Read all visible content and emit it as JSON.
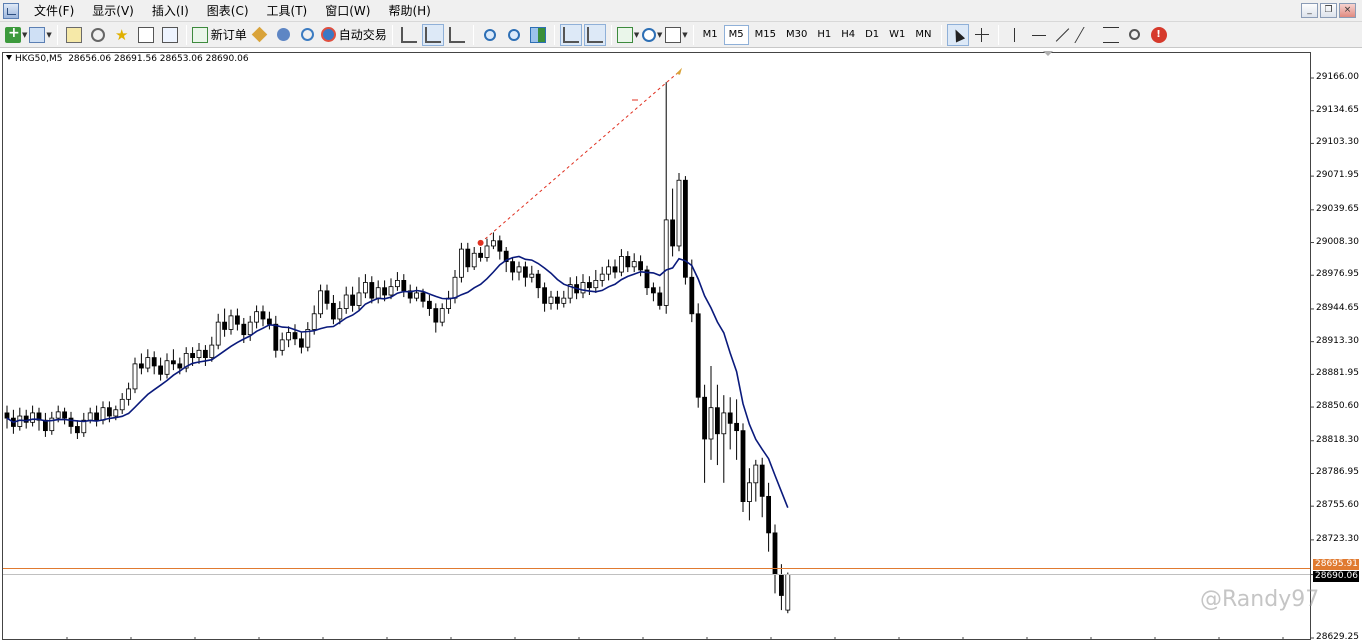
{
  "menu": {
    "items": [
      {
        "id": "file",
        "label": "文件(F)"
      },
      {
        "id": "view",
        "label": "显示(V)"
      },
      {
        "id": "insert",
        "label": "插入(I)"
      },
      {
        "id": "charts",
        "label": "图表(C)"
      },
      {
        "id": "tools",
        "label": "工具(T)"
      },
      {
        "id": "window",
        "label": "窗口(W)"
      },
      {
        "id": "help",
        "label": "帮助(H)"
      }
    ]
  },
  "window_controls": {
    "minimize": "_",
    "restore": "❐",
    "close": "×"
  },
  "toolbar": {
    "new_order_label": "新订单",
    "auto_trading_label": "自动交易",
    "alert_glyph": "!",
    "timeframes": [
      {
        "label": "M1",
        "active": false
      },
      {
        "label": "M5",
        "active": true
      },
      {
        "label": "M15",
        "active": false
      },
      {
        "label": "M30",
        "active": false
      },
      {
        "label": "H1",
        "active": false
      },
      {
        "label": "H4",
        "active": false
      },
      {
        "label": "D1",
        "active": false
      },
      {
        "label": "W1",
        "active": false
      },
      {
        "label": "MN",
        "active": false
      }
    ]
  },
  "chart_header": {
    "symbol": "HKG50,M5",
    "ohlc": "28656.06 28691.56 28653.06 28690.06"
  },
  "price_axis": {
    "labels": [
      "29166.00",
      "29134.65",
      "29103.30",
      "29071.95",
      "29039.65",
      "29008.30",
      "28976.95",
      "28944.65",
      "28913.30",
      "28881.95",
      "28850.60",
      "28818.30",
      "28786.95",
      "28755.60",
      "28723.30",
      "28690.06",
      "28629.25"
    ],
    "bid_price_tag": "28690.06",
    "ask_price_tag": "28695.91"
  },
  "watermark": "@Randy97",
  "colors": {
    "ma_line": "#0a1a7c",
    "trade_line": "#e03020",
    "bid_line": "#c0c0c0",
    "ask_line": "#e07a30",
    "candle_bear": "#000000",
    "candle_bull": "#ffffff",
    "tick_label_bg": "#000000",
    "ask_tag_bg": "#e07a30"
  },
  "chart_data": {
    "type": "candlestick",
    "symbol": "HKG50",
    "timeframe": "M5",
    "ylim": [
      28629.25,
      29180.0
    ],
    "grid": false,
    "indicators": [
      "moving average"
    ],
    "candles": [
      [
        28845,
        28840,
        28852,
        28830
      ],
      [
        28840,
        28832,
        28848,
        28825
      ],
      [
        28832,
        28842,
        28850,
        28828
      ],
      [
        28842,
        28836,
        28848,
        28830
      ],
      [
        28836,
        28845,
        28852,
        28832
      ],
      [
        28845,
        28838,
        28850,
        28828
      ],
      [
        28838,
        28828,
        28845,
        28822
      ],
      [
        28828,
        28840,
        28846,
        28824
      ],
      [
        28840,
        28846,
        28852,
        28836
      ],
      [
        28846,
        28840,
        28850,
        28834
      ],
      [
        28840,
        28832,
        28846,
        28825
      ],
      [
        28832,
        28826,
        28838,
        28820
      ],
      [
        28826,
        28838,
        28845,
        28822
      ],
      [
        28838,
        28845,
        28850,
        28835
      ],
      [
        28845,
        28838,
        28852,
        28832
      ],
      [
        28838,
        28850,
        28856,
        28834
      ],
      [
        28850,
        28842,
        28856,
        28836
      ],
      [
        28842,
        28848,
        28852,
        28838
      ],
      [
        28848,
        28858,
        28864,
        28844
      ],
      [
        28858,
        28868,
        28874,
        28852
      ],
      [
        28868,
        28892,
        28898,
        28864
      ],
      [
        28892,
        28888,
        28902,
        28882
      ],
      [
        28888,
        28898,
        28906,
        28884
      ],
      [
        28898,
        28890,
        28904,
        28882
      ],
      [
        28890,
        28882,
        28898,
        28876
      ],
      [
        28882,
        28895,
        28902,
        28878
      ],
      [
        28895,
        28892,
        28906,
        28886
      ],
      [
        28892,
        28888,
        28898,
        28882
      ],
      [
        28888,
        28902,
        28908,
        28884
      ],
      [
        28902,
        28898,
        28908,
        28890
      ],
      [
        28898,
        28905,
        28912,
        28892
      ],
      [
        28905,
        28898,
        28910,
        28890
      ],
      [
        28898,
        28910,
        28918,
        28894
      ],
      [
        28910,
        28932,
        28940,
        28906
      ],
      [
        28932,
        28925,
        28945,
        28918
      ],
      [
        28925,
        28938,
        28944,
        28920
      ],
      [
        28938,
        28930,
        28945,
        28924
      ],
      [
        28930,
        28920,
        28936,
        28912
      ],
      [
        28920,
        28932,
        28938,
        28914
      ],
      [
        28932,
        28942,
        28948,
        28926
      ],
      [
        28942,
        28935,
        28948,
        28928
      ],
      [
        28935,
        28930,
        28942,
        28925
      ],
      [
        28930,
        28905,
        28938,
        28898
      ],
      [
        28905,
        28915,
        28922,
        28900
      ],
      [
        28915,
        28922,
        28928,
        28908
      ],
      [
        28922,
        28916,
        28930,
        28910
      ],
      [
        28916,
        28908,
        28922,
        28902
      ],
      [
        28908,
        28925,
        28932,
        28904
      ],
      [
        28925,
        28940,
        28948,
        28920
      ],
      [
        28940,
        28962,
        28968,
        28936
      ],
      [
        28962,
        28950,
        28968,
        28944
      ],
      [
        28950,
        28935,
        28958,
        28930
      ],
      [
        28935,
        28945,
        28952,
        28930
      ],
      [
        28945,
        28958,
        28966,
        28940
      ],
      [
        28958,
        28948,
        28966,
        28942
      ],
      [
        28948,
        28960,
        28975,
        28944
      ],
      [
        28960,
        28970,
        28978,
        28955
      ],
      [
        28970,
        28955,
        28976,
        28950
      ],
      [
        28955,
        28965,
        28972,
        28950
      ],
      [
        28965,
        28958,
        28972,
        28952
      ],
      [
        28958,
        28966,
        28974,
        28954
      ],
      [
        28966,
        28972,
        28980,
        28962
      ],
      [
        28972,
        28962,
        28978,
        28956
      ],
      [
        28962,
        28955,
        28968,
        28950
      ],
      [
        28955,
        28960,
        28966,
        28952
      ],
      [
        28960,
        28952,
        28964,
        28946
      ],
      [
        28952,
        28945,
        28958,
        28938
      ],
      [
        28945,
        28932,
        28950,
        28922
      ],
      [
        28932,
        28945,
        28950,
        28928
      ],
      [
        28945,
        28955,
        28962,
        28940
      ],
      [
        28955,
        28975,
        28982,
        28950
      ],
      [
        28975,
        29002,
        29008,
        28970
      ],
      [
        29002,
        28985,
        29008,
        28980
      ],
      [
        28985,
        28998,
        29004,
        28982
      ],
      [
        28998,
        28994,
        29004,
        28990
      ],
      [
        28994,
        29005,
        29012,
        28990
      ],
      [
        29005,
        29010,
        29018,
        29002
      ],
      [
        29010,
        29000,
        29015,
        28992
      ],
      [
        29000,
        28990,
        29004,
        28980
      ],
      [
        28990,
        28980,
        28994,
        28972
      ],
      [
        28980,
        28985,
        28990,
        28972
      ],
      [
        28985,
        28975,
        28990,
        28966
      ],
      [
        28975,
        28978,
        28986,
        28970
      ],
      [
        28978,
        28965,
        28982,
        28955
      ],
      [
        28965,
        28950,
        28970,
        28942
      ],
      [
        28950,
        28956,
        28962,
        28944
      ],
      [
        28956,
        28950,
        28962,
        28944
      ],
      [
        28950,
        28955,
        28962,
        28946
      ],
      [
        28955,
        28968,
        28975,
        28950
      ],
      [
        28968,
        28960,
        28976,
        28954
      ],
      [
        28960,
        28970,
        28978,
        28955
      ],
      [
        28970,
        28965,
        28976,
        28958
      ],
      [
        28965,
        28972,
        28982,
        28960
      ],
      [
        28972,
        28978,
        28985,
        28966
      ],
      [
        28978,
        28985,
        28992,
        28972
      ],
      [
        28985,
        28980,
        28992,
        28974
      ],
      [
        28980,
        28995,
        29002,
        28976
      ],
      [
        28995,
        28985,
        29000,
        28980
      ],
      [
        28985,
        28990,
        28998,
        28980
      ],
      [
        28990,
        28982,
        28996,
        28976
      ],
      [
        28982,
        28965,
        28986,
        28958
      ],
      [
        28965,
        28960,
        28970,
        28952
      ],
      [
        28960,
        28948,
        28966,
        28944
      ],
      [
        28948,
        29030,
        29162,
        28940
      ],
      [
        29030,
        29005,
        29060,
        28995
      ],
      [
        29005,
        29068,
        29075,
        29000
      ],
      [
        29068,
        28975,
        29072,
        28968
      ],
      [
        28975,
        28940,
        28992,
        28932
      ],
      [
        28940,
        28860,
        28950,
        28850
      ],
      [
        28860,
        28820,
        28872,
        28778
      ],
      [
        28820,
        28850,
        28890,
        28800
      ],
      [
        28850,
        28825,
        28872,
        28795
      ],
      [
        28825,
        28845,
        28862,
        28778
      ],
      [
        28845,
        28835,
        28860,
        28810
      ],
      [
        28835,
        28828,
        28858,
        28800
      ],
      [
        28828,
        28760,
        28835,
        28750
      ],
      [
        28760,
        28778,
        28792,
        28742
      ],
      [
        28778,
        28795,
        28800,
        28760
      ],
      [
        28795,
        28765,
        28802,
        28745
      ],
      [
        28765,
        28730,
        28778,
        28712
      ],
      [
        28730,
        28690,
        28738,
        28672
      ],
      [
        28690,
        28670,
        28700,
        28656
      ],
      [
        28656,
        28690,
        28692,
        28653
      ]
    ]
  }
}
